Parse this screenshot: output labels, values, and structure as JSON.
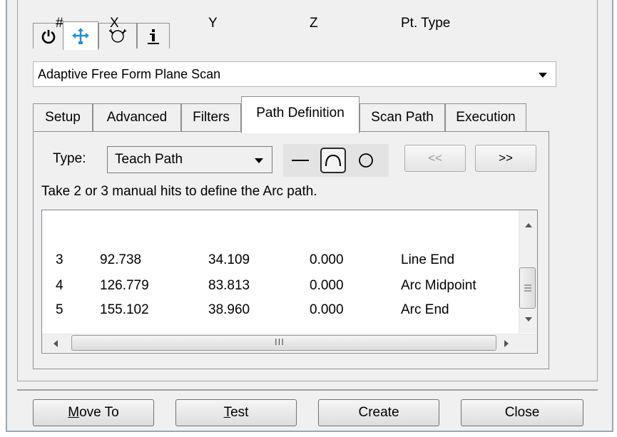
{
  "icon_tabs": [
    {
      "icon": "power-icon"
    },
    {
      "icon": "move-arrows-icon",
      "color": "#1e90d8"
    },
    {
      "icon": "probe-sphere-icon"
    },
    {
      "icon": "info-icon"
    }
  ],
  "scan_type": {
    "value": "Adaptive Free Form Plane Scan"
  },
  "tabs": [
    {
      "label": "Setup"
    },
    {
      "label": "Advanced"
    },
    {
      "label": "Filters"
    },
    {
      "label": "Path Definition",
      "active": true
    },
    {
      "label": "Scan Path"
    },
    {
      "label": "Execution"
    }
  ],
  "path_definition": {
    "type_label": "Type:",
    "type_value": "Teach Path",
    "shapes": [
      {
        "icon": "line-icon"
      },
      {
        "icon": "arc-icon",
        "selected": true
      },
      {
        "icon": "circle-icon"
      }
    ],
    "prev_label": "<<",
    "next_label": ">>",
    "instruction": "Take 2 or 3 manual hits to define the Arc path.",
    "columns": [
      "#",
      "X",
      "Y",
      "Z",
      "Pt. Type"
    ],
    "rows": [
      [
        "3",
        "92.738",
        "34.109",
        "0.000",
        "Line End"
      ],
      [
        "4",
        "126.779",
        "83.813",
        "0.000",
        "Arc Midpoint"
      ],
      [
        "5",
        "155.102",
        "38.960",
        "0.000",
        "Arc End"
      ]
    ],
    "hscroll_grip": "III"
  },
  "buttons": {
    "move_to_mnemonic": "M",
    "move_to_rest": "ove To",
    "test_mnemonic": "T",
    "test_rest": "est",
    "create": "Create",
    "close": "Close"
  }
}
